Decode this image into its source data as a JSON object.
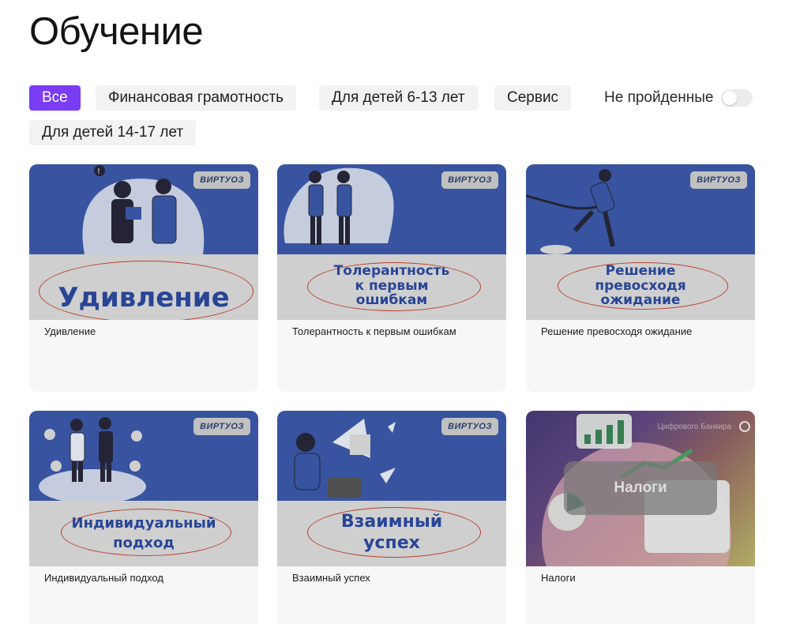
{
  "page": {
    "title": "Обучение"
  },
  "filters": {
    "items": [
      {
        "label": "Все",
        "active": true
      },
      {
        "label": "Финансовая грамотность",
        "active": false
      },
      {
        "label": "Для детей 6-13 лет",
        "active": false
      },
      {
        "label": "Сервис",
        "active": false
      },
      {
        "label": "Для детей 14-17 лет",
        "active": false
      }
    ],
    "toggle": {
      "label": "Не пройденные",
      "checked": false
    }
  },
  "colors": {
    "accent": "#7a3cf5",
    "cover_blue": "#3050a4",
    "oval_red": "#c03b24"
  },
  "cards": [
    {
      "title": "Удивление",
      "badge": "ВИРТУОЗ",
      "cover_lines": [
        "Удивление"
      ]
    },
    {
      "title": "Толерантность к первым ошибкам",
      "badge": "ВИРТУОЗ",
      "cover_lines": [
        "Толерантность",
        "к первым",
        "ошибкам"
      ]
    },
    {
      "title": "Решение превосходя ожидание",
      "badge": "ВИРТУОЗ",
      "cover_lines": [
        "Решение",
        "превосходя",
        "ожидание"
      ]
    },
    {
      "title": "Индивидуальный подход",
      "badge": "ВИРТУОЗ",
      "cover_lines": [
        "Индивидуальный",
        "подход"
      ]
    },
    {
      "title": "Взаимный успех",
      "badge": "ВИРТУОЗ",
      "cover_lines": [
        "Взаимный",
        "успех"
      ]
    },
    {
      "title": "Налоги",
      "cover_label": "Налоги",
      "cover_brand": "Цифрового Банкира"
    }
  ]
}
